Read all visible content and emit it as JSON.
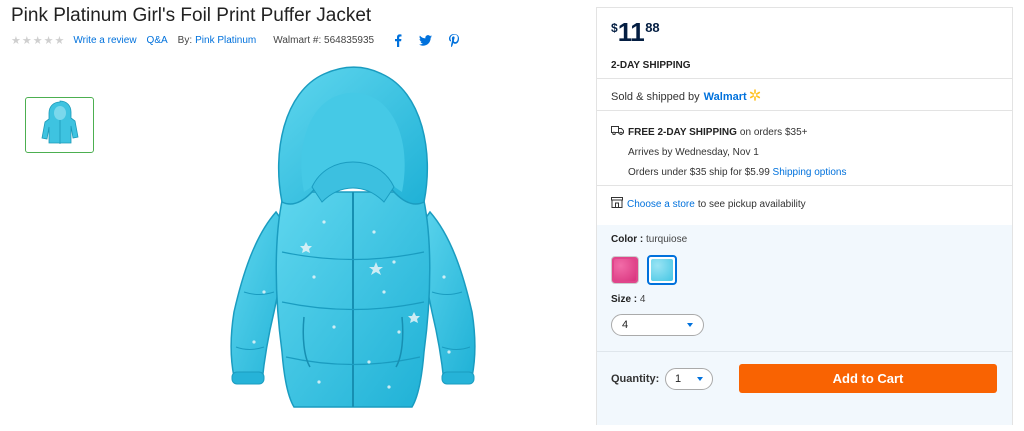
{
  "product": {
    "title": "Pink Platinum Girl's Foil Print Puffer Jacket",
    "rating_stars": 5,
    "write_review": "Write a review",
    "qa": "Q&A",
    "by_label": "By:",
    "brand": "Pink Platinum",
    "item_number": "Walmart #: 564835935"
  },
  "icons": {
    "social": [
      "facebook-icon",
      "twitter-icon",
      "pinterest-icon"
    ]
  },
  "price": {
    "currency": "$",
    "dollars": "11",
    "cents": "88"
  },
  "shipping": {
    "label": "2-DAY SHIPPING",
    "sold_by": "Sold & shipped by",
    "seller": "Walmart",
    "free_bold": "FREE 2-DAY SHIPPING",
    "free_rest": "on orders $35+",
    "arrives": "Arrives by Wednesday, Nov 1",
    "under": "Orders under $35 ship for $5.99",
    "options_link": "Shipping options"
  },
  "pickup": {
    "link": "Choose a store",
    "rest": "to see pickup availability"
  },
  "options": {
    "color_label": "Color :",
    "color_value": "turquiose",
    "colors": [
      "#e0458b",
      "#5ecbe8"
    ],
    "size_label": "Size :",
    "size_value": "4",
    "size_selected": "4"
  },
  "cart": {
    "qty_label": "Quantity:",
    "qty_value": "1",
    "button": "Add to Cart"
  },
  "colors": {
    "link": "#0071dc",
    "cart": "#f96302",
    "price": "#041e42",
    "jacket": "#3ec3e0"
  }
}
